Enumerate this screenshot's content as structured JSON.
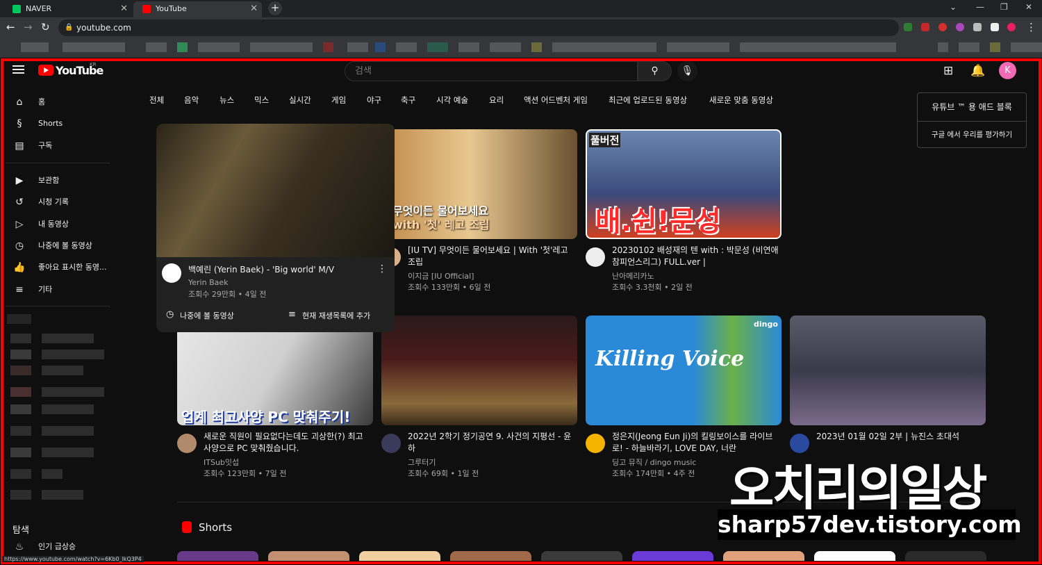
{
  "browser": {
    "tabs": [
      {
        "title": "NAVER",
        "color": "#03c75a"
      },
      {
        "title": "YouTube",
        "color": "#ff0000"
      }
    ],
    "address": "youtube.com",
    "status_url": "https://www.youtube.com/watch?v=6Kb0_lkQ3P4"
  },
  "header": {
    "logo_text": "YouTube",
    "logo_region": "KR",
    "search_placeholder": "검색",
    "avatar_letter": "K"
  },
  "sidebar": {
    "items": [
      {
        "label": "홈",
        "icon": "home-icon",
        "glyph": "⌂"
      },
      {
        "label": "Shorts",
        "icon": "shorts-icon",
        "glyph": "§"
      },
      {
        "label": "구독",
        "icon": "subscriptions-icon",
        "glyph": "▤"
      },
      {
        "label": "보관함",
        "icon": "library-icon",
        "glyph": "▶"
      },
      {
        "label": "시청 기록",
        "icon": "history-icon",
        "glyph": "↺"
      },
      {
        "label": "내 동영상",
        "icon": "my-videos-icon",
        "glyph": "▷"
      },
      {
        "label": "나중에 볼 동영상",
        "icon": "watch-later-icon",
        "glyph": "◷"
      },
      {
        "label": "좋아요 표시한 동영...",
        "icon": "liked-icon",
        "glyph": "👍"
      },
      {
        "label": "기타",
        "icon": "more-icon",
        "glyph": "≡"
      }
    ],
    "explore_title": "탐색",
    "explore_items": [
      {
        "label": "인기 급상승",
        "icon": "trending-icon",
        "glyph": "♨"
      }
    ]
  },
  "chips": [
    "전체",
    "음악",
    "뉴스",
    "믹스",
    "실시간",
    "게임",
    "야구",
    "축구",
    "시각 예술",
    "요리",
    "액션 어드벤처 게임",
    "최근에 업로드된 동영상",
    "새로운 맞춤 동영상"
  ],
  "ad_popup": {
    "primary": "유튜브 ™ 용 애드 블록",
    "secondary": "구글 에서 우리를 평가하기"
  },
  "hover_card": {
    "title": "백예린 (Yerin Baek) - 'Big world' M/V",
    "channel": "Yerin Baek",
    "meta": "조회수 29만회 • 4일 전",
    "action1": "나중에 볼 동영상",
    "action2": "현재 재생목록에 추가"
  },
  "videos_row1": [
    {
      "title": "[IU TV] 무엇이든 물어보세요 | With '첫'레고 조립",
      "channel": "이지금 [IU Official]",
      "meta": "조회수 133만회 • 6일 전",
      "thumb_text": "무엇이든 물어보세요",
      "thumb_text2": "with '첫' 레고 조립"
    },
    {
      "title": "20230102 배성재의 텐 with : 박문성 (비연애 참피언스리그) FULL.ver |",
      "channel": "난아메리카노",
      "meta": "조회수 3.3천회 • 2일 전",
      "thumb_text": "배.쉰!문성",
      "thumb_badge": "풀버전"
    }
  ],
  "videos_row2": [
    {
      "title": "새로운 직원이 필요없다는데도 괴상한(?) 최고사양으로 PC 맞춰줬습니다.",
      "channel": "ITSub잇섭",
      "meta": "조회수 123만회 • 7일 전",
      "thumb_text": "업계 최고사양 PC 맞춰주기!"
    },
    {
      "title": "2022년 2학기 정기공연 9. 사건의 지평선 - 윤하",
      "channel": "그루터기",
      "meta": "조회수 69회 • 1일 전"
    },
    {
      "title": "정은지(Jeong Eun Ji)의 킬링보이스를 라이브로! - 하늘바라기, LOVE DAY, 너란",
      "channel": "딩고 뮤직 / dingo music",
      "meta": "조회수 174만회 • 4주 전",
      "thumb_text": "Killing Voice",
      "thumb_badge": "dingo"
    },
    {
      "title": "2023년 01월 02일 2부 | 뉴진스 초대석",
      "channel": "",
      "meta": ""
    }
  ],
  "shorts_title": "Shorts",
  "watermark": {
    "line1": "오치리의일상",
    "line2": "sharp57dev.tistory.com"
  }
}
